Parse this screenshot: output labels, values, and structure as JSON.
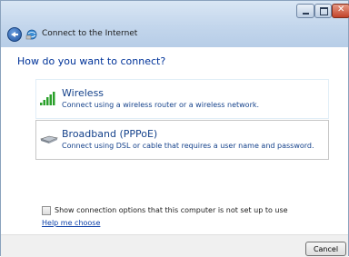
{
  "window": {
    "title": "Connect to the Internet"
  },
  "main": {
    "heading": "How do you want to connect?",
    "options": [
      {
        "title": "Wireless",
        "description": "Connect using a wireless router or a wireless network.",
        "icon": "wireless-signal-icon"
      },
      {
        "title": "Broadband (PPPoE)",
        "description": "Connect using DSL or cable that requires a user name and password.",
        "icon": "broadband-modem-icon"
      }
    ],
    "checkbox_label": "Show connection options that this computer is not set up to use",
    "checkbox_checked": false,
    "help_link": "Help me choose"
  },
  "footer": {
    "cancel_label": "Cancel"
  },
  "colors": {
    "heading": "#003399",
    "link": "#0b3fa8",
    "titlebar": "#c3d6ec"
  }
}
